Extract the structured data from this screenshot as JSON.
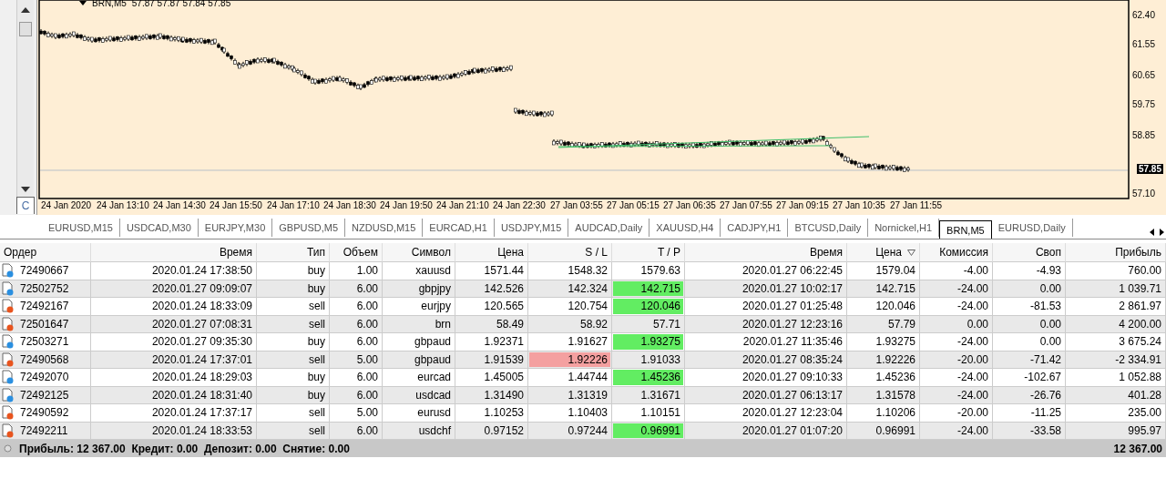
{
  "side_panel": {
    "tabs": [
      {
        "label": "C",
        "selected": true
      }
    ]
  },
  "chart": {
    "symbol": "BRN,M5",
    "ohlc": "57.87 57.87 57.84 57.85",
    "price_ticks": [
      "62.40",
      "61.55",
      "60.65",
      "59.75",
      "58.85",
      "57.10"
    ],
    "current_price": "57.85",
    "time_labels": [
      "24 Jan 2020",
      "24 Jan 13:10",
      "24 Jan 14:30",
      "24 Jan 15:50",
      "24 Jan 17:10",
      "24 Jan 18:30",
      "24 Jan 19:50",
      "24 Jan 21:10",
      "24 Jan 22:30",
      "27 Jan 03:55",
      "27 Jan 05:15",
      "27 Jan 06:35",
      "27 Jan 07:55",
      "27 Jan 09:15",
      "27 Jan 10:35",
      "27 Jan 11:55"
    ]
  },
  "chart_tabs": [
    {
      "label": "EURUSD,M15",
      "selected": false
    },
    {
      "label": "USDCAD,M30",
      "selected": false
    },
    {
      "label": "EURJPY,M30",
      "selected": false
    },
    {
      "label": "GBPUSD,M5",
      "selected": false
    },
    {
      "label": "NZDUSD,M15",
      "selected": false
    },
    {
      "label": "EURCAD,H1",
      "selected": false
    },
    {
      "label": "USDJPY,M15",
      "selected": false
    },
    {
      "label": "AUDCAD,Daily",
      "selected": false
    },
    {
      "label": "XAUUSD,H4",
      "selected": false
    },
    {
      "label": "CADJPY,H1",
      "selected": false
    },
    {
      "label": "BTCUSD,Daily",
      "selected": false
    },
    {
      "label": "Nornickel,H1",
      "selected": false
    },
    {
      "label": "BRN,M5",
      "selected": true
    },
    {
      "label": "EURUSD,Daily",
      "selected": false
    }
  ],
  "table": {
    "columns": [
      {
        "label": "Ордер",
        "sorted": false
      },
      {
        "label": "Время",
        "sorted": false
      },
      {
        "label": "Тип",
        "sorted": false
      },
      {
        "label": "Объем",
        "sorted": false
      },
      {
        "label": "Символ",
        "sorted": false
      },
      {
        "label": "Цена",
        "sorted": false
      },
      {
        "label": "S / L",
        "sorted": false
      },
      {
        "label": "T / P",
        "sorted": false
      },
      {
        "label": "Время",
        "sorted": false
      },
      {
        "label": "Цена",
        "sorted": true
      },
      {
        "label": "Комиссия",
        "sorted": false
      },
      {
        "label": "Своп",
        "sorted": false
      },
      {
        "label": "Прибыль",
        "sorted": false
      }
    ],
    "rows": [
      {
        "kind": "buy",
        "cells": [
          "72490667",
          "2020.01.24 17:38:50",
          "buy",
          "1.00",
          "xauusd",
          "1571.44",
          "1548.32",
          "1579.63",
          "2020.01.27 06:22:45",
          "1579.04",
          "-4.00",
          "-4.93",
          "760.00"
        ],
        "sl_hit": false,
        "tp_hit": false
      },
      {
        "kind": "buy",
        "cells": [
          "72502752",
          "2020.01.27 09:09:07",
          "buy",
          "6.00",
          "gbpjpy",
          "142.526",
          "142.324",
          "142.715",
          "2020.01.27 10:02:17",
          "142.715",
          "-24.00",
          "0.00",
          "1 039.71"
        ],
        "sl_hit": false,
        "tp_hit": true
      },
      {
        "kind": "sell",
        "cells": [
          "72492167",
          "2020.01.24 18:33:09",
          "sell",
          "6.00",
          "eurjpy",
          "120.565",
          "120.754",
          "120.046",
          "2020.01.27 01:25:48",
          "120.046",
          "-24.00",
          "-81.53",
          "2 861.97"
        ],
        "sl_hit": false,
        "tp_hit": true
      },
      {
        "kind": "sell",
        "cells": [
          "72501647",
          "2020.01.27 07:08:31",
          "sell",
          "6.00",
          "brn",
          "58.49",
          "58.92",
          "57.71",
          "2020.01.27 12:23:16",
          "57.79",
          "0.00",
          "0.00",
          "4 200.00"
        ],
        "sl_hit": false,
        "tp_hit": false
      },
      {
        "kind": "buy",
        "cells": [
          "72503271",
          "2020.01.27 09:35:30",
          "buy",
          "6.00",
          "gbpaud",
          "1.92371",
          "1.91627",
          "1.93275",
          "2020.01.27 11:35:46",
          "1.93275",
          "-24.00",
          "0.00",
          "3 675.24"
        ],
        "sl_hit": false,
        "tp_hit": true
      },
      {
        "kind": "sell",
        "cells": [
          "72490568",
          "2020.01.24 17:37:01",
          "sell",
          "5.00",
          "gbpaud",
          "1.91539",
          "1.92226",
          "1.91033",
          "2020.01.27 08:35:24",
          "1.92226",
          "-20.00",
          "-71.42",
          "-2 334.91"
        ],
        "sl_hit": true,
        "tp_hit": false
      },
      {
        "kind": "buy",
        "cells": [
          "72492070",
          "2020.01.24 18:29:03",
          "buy",
          "6.00",
          "eurcad",
          "1.45005",
          "1.44744",
          "1.45236",
          "2020.01.27 09:10:33",
          "1.45236",
          "-24.00",
          "-102.67",
          "1 052.88"
        ],
        "sl_hit": false,
        "tp_hit": true
      },
      {
        "kind": "buy",
        "cells": [
          "72492125",
          "2020.01.24 18:31:40",
          "buy",
          "6.00",
          "usdcad",
          "1.31490",
          "1.31319",
          "1.31671",
          "2020.01.27 06:13:17",
          "1.31578",
          "-24.00",
          "-26.76",
          "401.28"
        ],
        "sl_hit": false,
        "tp_hit": false
      },
      {
        "kind": "sell",
        "cells": [
          "72490592",
          "2020.01.24 17:37:17",
          "sell",
          "5.00",
          "eurusd",
          "1.10253",
          "1.10403",
          "1.10151",
          "2020.01.27 12:23:04",
          "1.10206",
          "-20.00",
          "-11.25",
          "235.00"
        ],
        "sl_hit": false,
        "tp_hit": false
      },
      {
        "kind": "sell",
        "cells": [
          "72492211",
          "2020.01.24 18:33:53",
          "sell",
          "6.00",
          "usdchf",
          "0.97152",
          "0.97244",
          "0.96991",
          "2020.01.27 01:07:20",
          "0.96991",
          "-24.00",
          "-33.58",
          "995.97"
        ],
        "sl_hit": false,
        "tp_hit": true
      }
    ]
  },
  "summary": {
    "text": "Прибыль: 12 367.00  Кредит: 0.00  Депозит: 0.00  Снятие: 0.00",
    "total": "12 367.00"
  }
}
